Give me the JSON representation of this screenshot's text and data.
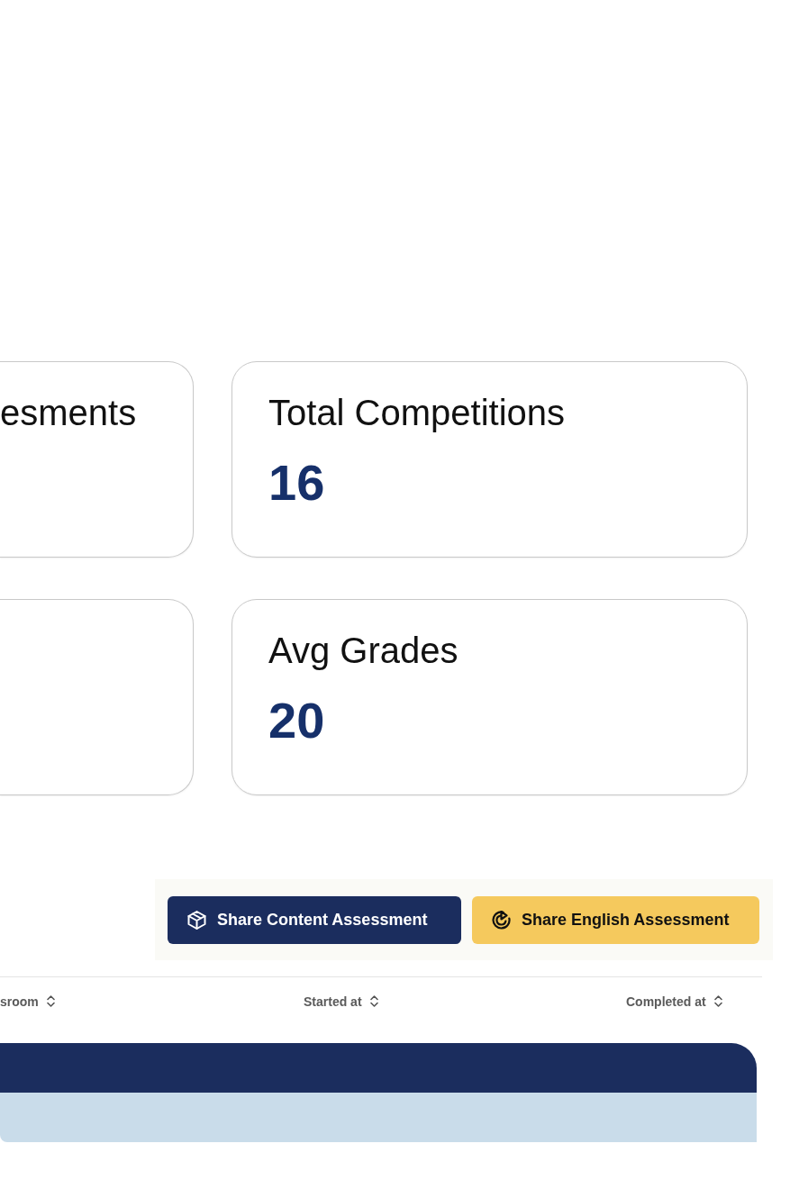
{
  "stat_cards": [
    {
      "kind": "partial",
      "label": "esments"
    },
    {
      "kind": "full",
      "label": "Total Competitions",
      "value": "16"
    },
    {
      "kind": "partial"
    },
    {
      "kind": "full",
      "label": "Avg Grades",
      "value": "20"
    }
  ],
  "toolbar": {
    "buttons": [
      {
        "kind": "primary",
        "label": "Share Content Assessment"
      },
      {
        "kind": "accent",
        "label": "Share English Assessment"
      }
    ]
  },
  "table": {
    "columns": [
      {
        "label": "sroom"
      },
      {
        "label": "Started at"
      },
      {
        "label": "Completed at"
      }
    ]
  }
}
